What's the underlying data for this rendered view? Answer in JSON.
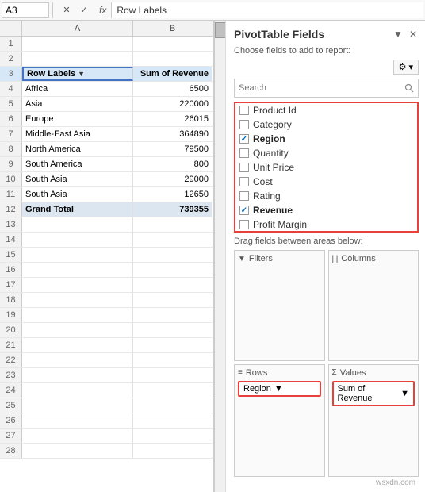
{
  "formulaBar": {
    "cellRef": "A3",
    "cancelLabel": "✕",
    "confirmLabel": "✓",
    "fxLabel": "fx",
    "formulaValue": "Row Labels"
  },
  "spreadsheet": {
    "colHeaders": [
      "",
      "A",
      "B"
    ],
    "rows": [
      {
        "rowNum": "1",
        "colA": "",
        "colB": ""
      },
      {
        "rowNum": "2",
        "colA": "",
        "colB": ""
      },
      {
        "rowNum": "3",
        "colA": "Row Labels",
        "colB": "Sum of Revenue",
        "type": "header"
      },
      {
        "rowNum": "4",
        "colA": "Africa",
        "colB": "6500"
      },
      {
        "rowNum": "5",
        "colA": "Asia",
        "colB": "220000"
      },
      {
        "rowNum": "6",
        "colA": "Europe",
        "colB": "26015"
      },
      {
        "rowNum": "7",
        "colA": "Middle-East Asia",
        "colB": "364890"
      },
      {
        "rowNum": "8",
        "colA": "North America",
        "colB": "79500"
      },
      {
        "rowNum": "9",
        "colA": "South America",
        "colB": "800"
      },
      {
        "rowNum": "10",
        "colA": "South Asia",
        "colB": "29000"
      },
      {
        "rowNum": "11",
        "colA": "South Asia",
        "colB": "12650"
      },
      {
        "rowNum": "12",
        "colA": "Grand Total",
        "colB": "739355",
        "type": "grand_total"
      },
      {
        "rowNum": "13",
        "colA": "",
        "colB": ""
      },
      {
        "rowNum": "14",
        "colA": "",
        "colB": ""
      },
      {
        "rowNum": "15",
        "colA": "",
        "colB": ""
      },
      {
        "rowNum": "16",
        "colA": "",
        "colB": ""
      },
      {
        "rowNum": "17",
        "colA": "",
        "colB": ""
      },
      {
        "rowNum": "18",
        "colA": "",
        "colB": ""
      },
      {
        "rowNum": "19",
        "colA": "",
        "colB": ""
      },
      {
        "rowNum": "20",
        "colA": "",
        "colB": ""
      },
      {
        "rowNum": "21",
        "colA": "",
        "colB": ""
      },
      {
        "rowNum": "22",
        "colA": "",
        "colB": ""
      },
      {
        "rowNum": "23",
        "colA": "",
        "colB": ""
      },
      {
        "rowNum": "24",
        "colA": "",
        "colB": ""
      },
      {
        "rowNum": "25",
        "colA": "",
        "colB": ""
      },
      {
        "rowNum": "26",
        "colA": "",
        "colB": ""
      },
      {
        "rowNum": "27",
        "colA": "",
        "colB": ""
      },
      {
        "rowNum": "28",
        "colA": "",
        "colB": ""
      }
    ]
  },
  "pivot": {
    "title": "PivotTable Fields",
    "chevronIcon": "▼",
    "closeIcon": "✕",
    "subtitle": "Choose fields to add to report:",
    "gearIcon": "⚙",
    "gearDropdown": "▾",
    "search": {
      "placeholder": "Search",
      "icon": "🔍"
    },
    "fields": [
      {
        "label": "Product Id",
        "checked": false
      },
      {
        "label": "Category",
        "checked": false
      },
      {
        "label": "Region",
        "checked": true,
        "bold": true
      },
      {
        "label": "Quantity",
        "checked": false
      },
      {
        "label": "Unit Price",
        "checked": false
      },
      {
        "label": "Cost",
        "checked": false
      },
      {
        "label": "Rating",
        "checked": false
      },
      {
        "label": "Revenue",
        "checked": true,
        "bold": true
      },
      {
        "label": "Profit Margin",
        "checked": false
      }
    ],
    "dragLabel": "Drag fields between areas below:",
    "areas": [
      {
        "id": "filters",
        "icon": "▼",
        "title": "Filters",
        "chip": null
      },
      {
        "id": "columns",
        "icon": "|||",
        "title": "Columns",
        "chip": null
      },
      {
        "id": "rows",
        "icon": "≡",
        "title": "Rows",
        "chip": {
          "label": "Region",
          "dropdown": "▼"
        }
      },
      {
        "id": "values",
        "icon": "Σ",
        "title": "Values",
        "chip": {
          "label": "Sum of Revenue",
          "dropdown": "▼"
        }
      }
    ]
  },
  "watermark": "wsxdn.com"
}
